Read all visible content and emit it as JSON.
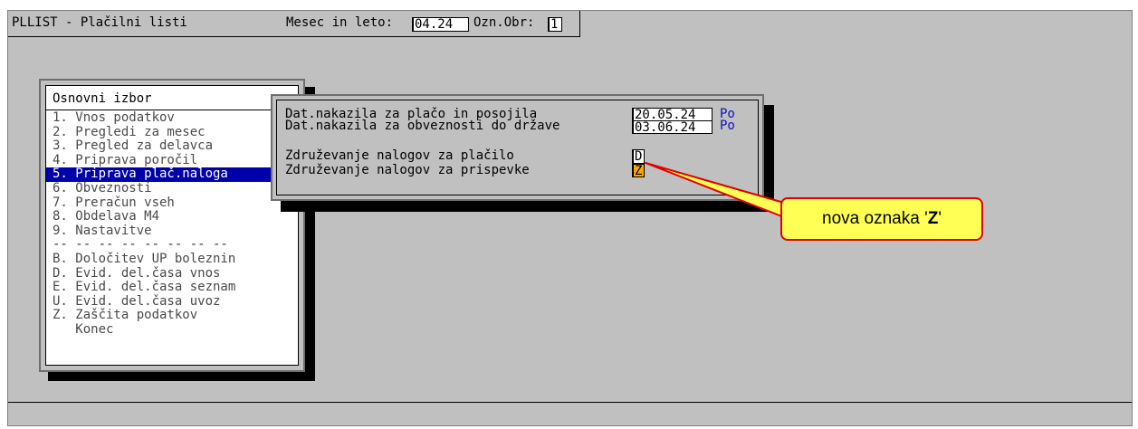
{
  "header": {
    "app_title": "PLLIST - Plačilni listi",
    "period_label": "Mesec in leto:",
    "period_value": "04.24",
    "ozn_label": "Ozn.Obr:",
    "ozn_value": "1"
  },
  "menu": {
    "title": "Osnovni izbor",
    "items": [
      {
        "label": "1. Vnos podatkov"
      },
      {
        "label": "2. Pregledi za mesec"
      },
      {
        "label": "3. Pregled za delavca"
      },
      {
        "label": "4. Priprava poročil"
      },
      {
        "label": "5. Priprava plač.naloga"
      },
      {
        "label": "6. Obveznosti"
      },
      {
        "label": "7. Preračun vseh"
      },
      {
        "label": "8. Obdelava M4"
      },
      {
        "label": "9. Nastavitve"
      },
      {
        "label": "-- -- -- -- -- -- -- --"
      },
      {
        "label": "B. Določitev UP boleznin"
      },
      {
        "label": "D. Evid. del.časa vnos"
      },
      {
        "label": "E. Evid. del.časa seznam"
      },
      {
        "label": "U. Evid. del.časa uvoz"
      },
      {
        "label": "Z. Zaščita podatkov"
      },
      {
        "label": "   Konec"
      }
    ],
    "selected_index": 4
  },
  "dialog": {
    "row1_label": "Dat.nakazila za plačo in posojila",
    "row1_value": "20.05.24",
    "row1_day": "Po",
    "row2_label": "Dat.nakazila za obveznosti do države",
    "row2_value": "03.06.24",
    "row2_day": "Po",
    "row3_label": "Združevanje nalogov za plačilo",
    "row3_value": "D",
    "row4_label": "Združevanje nalogov za prispevke",
    "row4_value": "Z"
  },
  "callout": {
    "prefix": "nova oznaka '",
    "highlight": "Z",
    "suffix": "'"
  },
  "colors": {
    "background": "#c0c0c0",
    "selection": "#0000aa",
    "day_text": "#1010c0",
    "highlight_field": "#ffa500",
    "callout_fill": "#ffff55",
    "callout_border": "#e00000"
  }
}
